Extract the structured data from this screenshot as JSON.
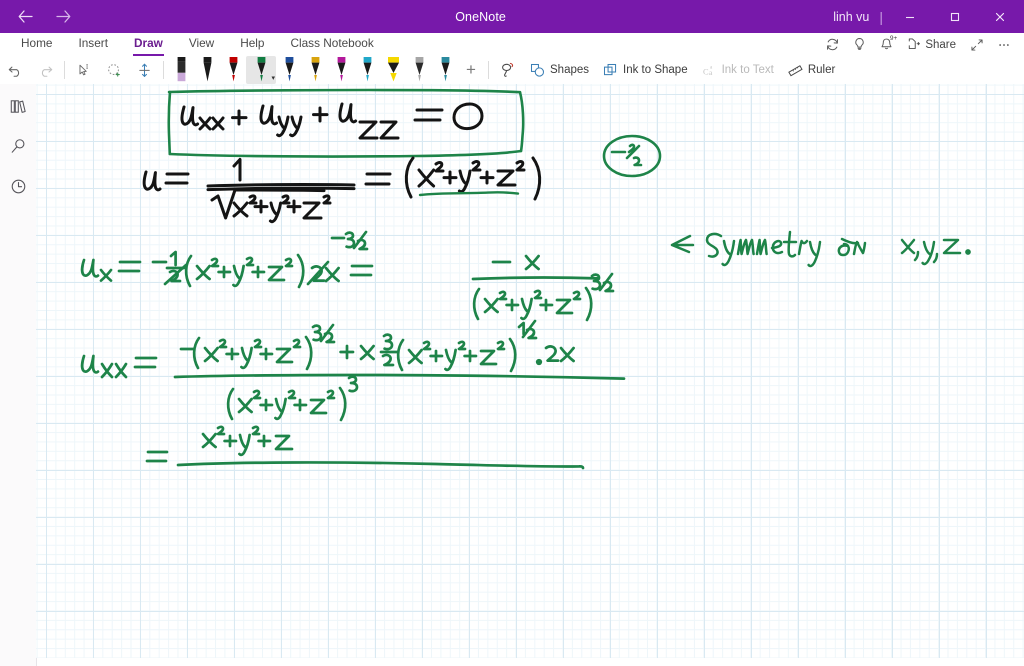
{
  "titlebar": {
    "back_icon": "back-arrow-icon",
    "forward_icon": "forward-arrow-icon",
    "title": "OneNote",
    "user": "linh vu",
    "separator": "|",
    "minimize": "–",
    "maximize": "❐",
    "close": "✕"
  },
  "ribbon": {
    "tabs": [
      {
        "label": "Home",
        "active": false
      },
      {
        "label": "Insert",
        "active": false
      },
      {
        "label": "Draw",
        "active": true
      },
      {
        "label": "View",
        "active": false
      },
      {
        "label": "Help",
        "active": false
      },
      {
        "label": "Class Notebook",
        "active": false
      }
    ],
    "right_icons": [
      {
        "name": "sync-icon",
        "glyph": "⟳"
      },
      {
        "name": "lightbulb-icon",
        "glyph": "Ὂ1"
      },
      {
        "name": "notifications-bell-icon",
        "glyph": "ὑ4",
        "badge": "9+"
      }
    ],
    "share_label": "Share",
    "share_icon": "share-icon",
    "expand_icon": "expand-icon",
    "more_icon": "more-options-icon",
    "more_glyph": "⋯"
  },
  "drawtoolbar": {
    "undo_label": "Undo",
    "redo_label": "Redo",
    "select_ink_label": "Lasso Select",
    "eraser_label": "Eraser",
    "insert_space_label": "Insert Space",
    "pens": [
      {
        "name": "highlighter-lavender",
        "color": "#c9a8d8",
        "type": "highlighter",
        "selected": false
      },
      {
        "name": "pen-black",
        "color": "#1a1a1a",
        "type": "pen",
        "selected": false
      },
      {
        "name": "pen-red",
        "color": "#c00000",
        "type": "pen",
        "selected": false
      },
      {
        "name": "pen-green",
        "color": "#107c41",
        "type": "pen",
        "selected": true
      },
      {
        "name": "pen-blue",
        "color": "#1f4e9c",
        "type": "pen",
        "selected": false
      },
      {
        "name": "pen-gold",
        "color": "#d9a40e",
        "type": "pen",
        "selected": false
      },
      {
        "name": "pen-magenta",
        "color": "#b3189b",
        "type": "pen",
        "selected": false
      },
      {
        "name": "pen-cyan",
        "color": "#21a8c9",
        "type": "pen",
        "selected": false
      },
      {
        "name": "highlighter-yellow",
        "color": "#f5d800",
        "type": "highlighter",
        "selected": false
      },
      {
        "name": "pen-silver",
        "color": "#a6a6a6",
        "type": "pen",
        "selected": false
      },
      {
        "name": "pen-teal",
        "color": "#2a8a9e",
        "type": "pen",
        "selected": false
      }
    ],
    "add_pen_label": "+",
    "lasso_icon": "lasso-select-icon",
    "shapes_label": "Shapes",
    "ink_to_shape_label": "Ink to Shape",
    "ink_to_text_label": "Ink to Text",
    "ink_to_text_disabled": true,
    "ruler_label": "Ruler"
  },
  "rail": {
    "items": [
      {
        "name": "notebooks-icon",
        "label": "Notebooks"
      },
      {
        "name": "search-icon",
        "label": "Search"
      },
      {
        "name": "recent-icon",
        "label": "Recent Notes"
      }
    ]
  },
  "canvas": {
    "ink_color_green": "#1e8449",
    "ink_color_black": "#111111",
    "grid_color": "#d9e9f2",
    "notes": [
      {
        "id": "boxed-laplace-equation",
        "text": "u_xx + u_yy + u_zz = 0",
        "color": "#1e8449",
        "boxed": true
      },
      {
        "id": "u-definition",
        "text": "u = 1 / sqrt(x^2+y^2+z^2) = (x^2+y^2+z^2)^(-1/2)",
        "color": "#111111"
      },
      {
        "id": "exponent-circle-annotation",
        "text": "-1/2",
        "color": "#1e8449"
      },
      {
        "id": "symmetry-note",
        "text": "Symmetry on x,y,z.",
        "color": "#1e8449"
      },
      {
        "id": "ux-derivative",
        "text": "u_x = -1/2 (x^2+y^2+z^2)^(-3/2) 2x  =  -x / (x^2+y^2+z^2)^(3/2)",
        "color": "#1e8449"
      },
      {
        "id": "uxx-derivative",
        "text": "u_xx = [ -(x^2+y^2+z^2)^(3/2) + x (3/2)(x^2+y^2+z^2)^(1/2) . 2x ] / (x^2+y^2+z^2)^3",
        "color": "#1e8449"
      },
      {
        "id": "uxx-simplified",
        "text": "= x^2+y^2+z / ____",
        "color": "#1e8449"
      }
    ]
  }
}
